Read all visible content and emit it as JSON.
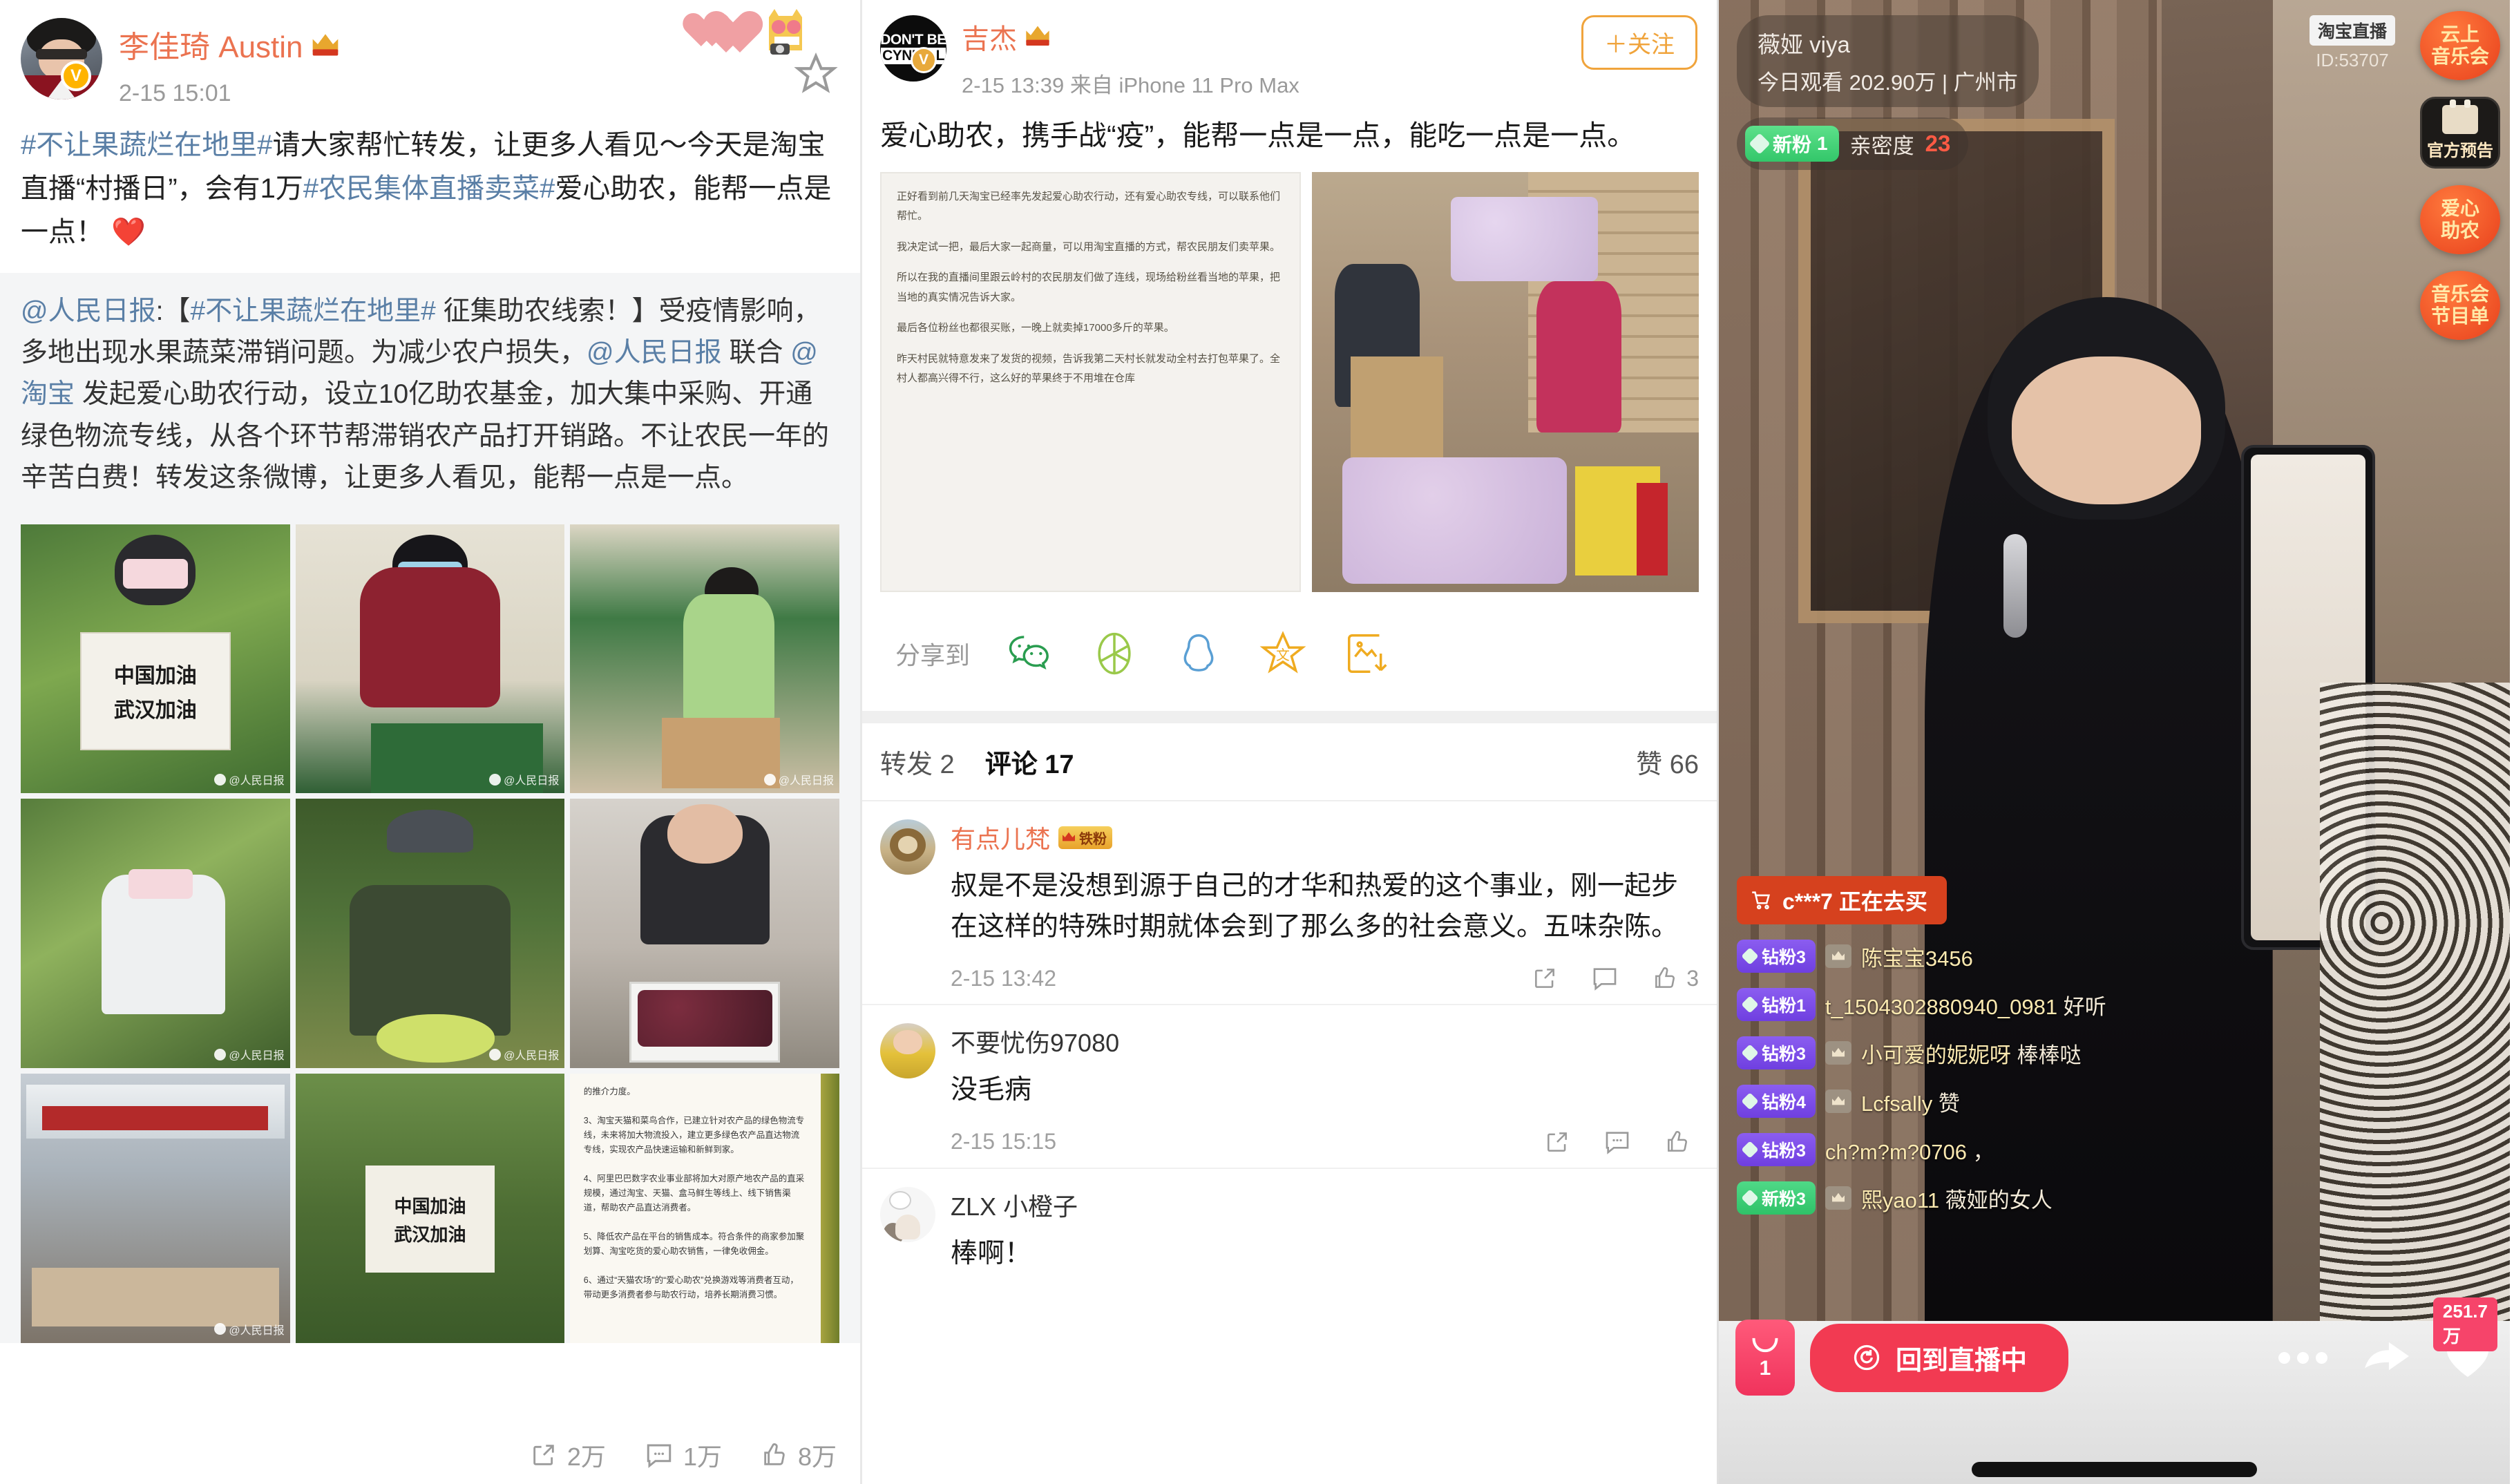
{
  "panel1": {
    "user": {
      "name": "李佳琦 Austin",
      "time": "2-15 15:01",
      "verified_badge": "V"
    },
    "post_text_parts": [
      {
        "t": "#不让果蔬烂在地里#",
        "link": true
      },
      {
        "t": "请大家帮忙转发，让更多人看见～今天是淘宝直播“村播日”，会有1万",
        "link": false
      },
      {
        "t": "#农民集体直播卖菜#",
        "link": true
      },
      {
        "t": "爱心助农，能帮一点是一点！ ❤️",
        "link": false
      }
    ],
    "quote_parts": [
      {
        "t": "@人民日报",
        "link": true
      },
      {
        "t": ":【",
        "link": false
      },
      {
        "t": "#不让果蔬烂在地里#",
        "link": true
      },
      {
        "t": " 征集助农线索！】受疫情影响，多地出现水果蔬菜滞销问题。为减少农户损失，",
        "link": false
      },
      {
        "t": "@人民日报",
        "link": true
      },
      {
        "t": " 联合 ",
        "link": false
      },
      {
        "t": "@淘宝",
        "link": true
      },
      {
        "t": " 发起爱心助农行动，设立10亿助农基金，加大集中采购、开通绿色物流专线，从各个环节帮滞销农产品打开销路。不让农民一年的辛苦白费！转发这条微博，让更多人看见，能帮一点是一点。",
        "link": false
      }
    ],
    "photos": [
      {
        "name": "farmer-holding-sign-greenhouse",
        "sign_line1": "中国加油",
        "sign_line2": "武汉加油",
        "watermark": "@人民日报"
      },
      {
        "name": "man-packing-green-box",
        "watermark": "@人民日报"
      },
      {
        "name": "workers-packing-warehouse",
        "watermark": "@人民日报"
      },
      {
        "name": "farmer-in-leaf-field",
        "watermark": "@人民日报"
      },
      {
        "name": "farmer-holding-mangoes",
        "watermark": "@人民日报"
      },
      {
        "name": "man-holding-passionfruit-crate",
        "watermark": ""
      },
      {
        "name": "outdoor-relief-tent",
        "watermark": "@人民日报"
      },
      {
        "name": "farmer-sign-in-field",
        "sign_line1": "中国加油",
        "sign_line2": "武汉加油",
        "watermark": ""
      },
      {
        "name": "announcement-text-card",
        "doc_text": "的推介力度。\n\n3、淘宝天猫和菜鸟合作，已建立针对农产品的绿色物流专线，未来将加大物流投入，建立更多绿色农产品直达物流专线，实现农产品快速运输和新鲜到家。\n\n4、阿里巴巴数字农业事业部将加大对原产地农产品的直采规模，通过淘宝、天猫、盒马鲜生等线上、线下销售渠道，帮助农产品直达消费者。\n\n5、降低农产品在平台的销售成本。符合条件的商家参加聚划算、淘宝吃货的爱心助农销售，一律免收佣金。\n\n6、通过“天猫农场”的“爱心助农”兑换游戏等消费者互动，带动更多消费者参与助农行动，培养长期消费习惯。"
      }
    ],
    "stats": {
      "repost": "2万",
      "comment": "1万",
      "like": "8万"
    }
  },
  "panel2": {
    "user": {
      "name": "吉杰",
      "time": "2-15 13:39 来自 iPhone 11 Pro Max",
      "avatar_line1": "DON'T BE",
      "avatar_line2": "CYNICAL",
      "verified_badge": "V"
    },
    "follow_button": "＋关注",
    "post_text": "爱心助农，携手战“疫”，能帮一点是一点，能吃一点是一点。",
    "text_card_paragraphs": [
      "正好看到前几天淘宝已经率先发起爱心助农行动，还有爱心助农专线，可以联系他们帮忙。",
      "我决定试一把，最后大家一起商量，可以用淘宝直播的方式，帮农民朋友们卖苹果。",
      "所以在我的直播间里跟云岭村的农民朋友们做了连线，现场给粉丝看当地的苹果，把当地的真实情况告诉大家。",
      "最后各位粉丝也都很买账，一晚上就卖掉17000多斤的苹果。",
      "昨天村民就特意发来了发货的视频，告诉我第二天村长就发动全村去打包苹果了。全村人都高兴得不行，这么好的苹果终于不用堆在仓库"
    ],
    "photo_name": "villagers-packing-apples",
    "share_label": "分享到",
    "share_targets": [
      "wechat-icon",
      "alipay-icon",
      "qq-icon",
      "star-icon",
      "save-image-icon"
    ],
    "tabs": {
      "repost": "转发 2",
      "comment": "评论 17",
      "like": "赞 66"
    },
    "comments": [
      {
        "name": "有点儿梵",
        "badge": "铁粉",
        "text": "叔是不是没想到源于自己的才华和热爱的这个事业，刚一起步在这样的特殊时期就体会到了那么多的社会意义。五味杂陈。",
        "time": "2-15 13:42",
        "likes": "3",
        "avatar": "lion-photo-avatar"
      },
      {
        "name": "不要忧伤97080",
        "badge": "",
        "text": "没毛病",
        "time": "2-15 15:15",
        "likes": "",
        "avatar": "yellow-jacket-avatar"
      },
      {
        "name": "ZLX 小橙子",
        "badge": "",
        "text": "棒啊！",
        "time": "",
        "likes": "",
        "avatar": "cartoon-cat-avatar"
      }
    ]
  },
  "panel3": {
    "host": {
      "name": "薇娅 viya",
      "views_line": "今日观看 202.90万 | 广州市"
    },
    "fans_chip": {
      "label": "新粉",
      "level": "1",
      "intimacy_label": "亲密度",
      "intimacy_value": "23"
    },
    "taobao_tag": {
      "label": "淘宝直播",
      "id": "ID:53707"
    },
    "right_buttons": [
      {
        "name": "cloud-concert-button",
        "line1": "云上",
        "line2": "音乐会",
        "style": "orange"
      },
      {
        "name": "official-preview-button",
        "label": "官方预告",
        "style": "dark"
      },
      {
        "name": "love-help-farmers-button",
        "line1": "爱心",
        "line2": "助农",
        "style": "orange"
      },
      {
        "name": "concert-program-button",
        "line1": "音乐会",
        "line2": "节目单",
        "style": "orange"
      }
    ],
    "buy_notice": "c***7 正在去买",
    "chat": [
      {
        "badge": "钻粉3",
        "badge_type": "purple",
        "crown": true,
        "user": "陈宝宝3456",
        "msg": ""
      },
      {
        "badge": "钻粉1",
        "badge_type": "purple",
        "crown": false,
        "user": "t_1504302880940_0981",
        "msg": "好听"
      },
      {
        "badge": "钻粉3",
        "badge_type": "purple",
        "crown": true,
        "user": "小可爱的妮妮呀",
        "msg": "棒棒哒"
      },
      {
        "badge": "钻粉4",
        "badge_type": "purple",
        "crown": true,
        "user": "Lcfsally",
        "msg": "赞"
      },
      {
        "badge": "钻粉3",
        "badge_type": "purple",
        "crown": false,
        "user": "ch?m?m?0706",
        "msg": "，"
      },
      {
        "badge": "新粉3",
        "badge_type": "green",
        "crown": true,
        "user": "熙yao11",
        "msg": "薇娅的女人"
      }
    ],
    "bag_count": "1",
    "back_to_live": "回到直播中",
    "like_count": "251.7万"
  },
  "colors": {
    "weibo_orange": "#eb7350",
    "link_blue": "#5a7fa6",
    "live_red": "#f23a52",
    "taobao_orange": "#e8401c",
    "fans_purple": "#6f3fe0",
    "fans_green": "#2fc268"
  }
}
